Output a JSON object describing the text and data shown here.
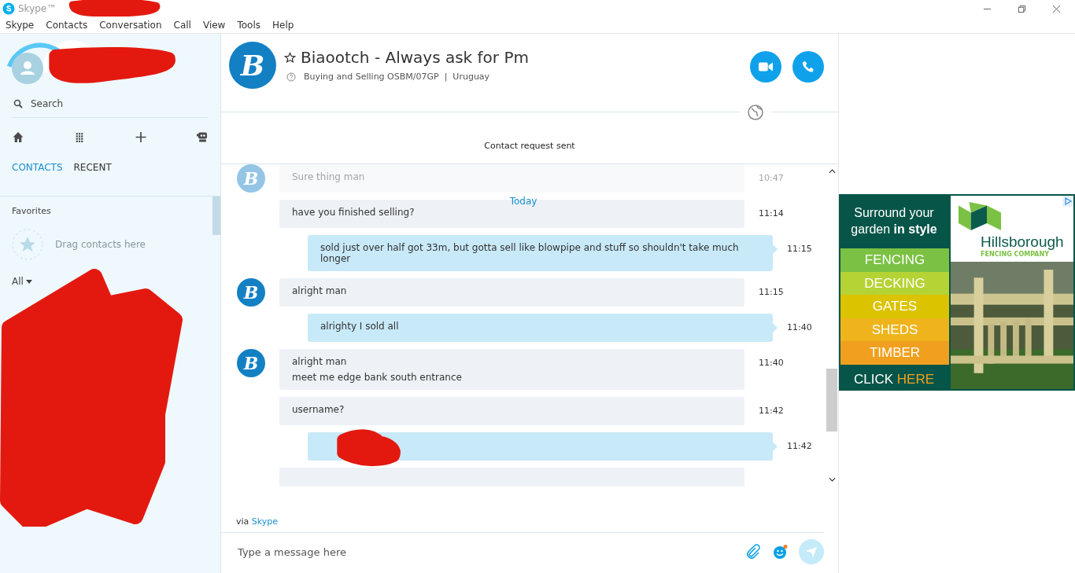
{
  "window": {
    "title": "Skype™"
  },
  "menu": [
    "Skype",
    "Contacts",
    "Conversation",
    "Call",
    "View",
    "Tools",
    "Help"
  ],
  "sidebar": {
    "search": "Search",
    "tabs": [
      {
        "label": "CONTACTS",
        "selected": true
      },
      {
        "label": "RECENT",
        "selected": false
      }
    ],
    "favorites": "Favorites",
    "drag_hint": "Drag contacts here",
    "filter": "All"
  },
  "chat": {
    "avatar_letter": "B",
    "name": "Biaootch - Always ask for Pm",
    "mood": "Buying and Selling OSBM/07GP",
    "separator": "|",
    "location": "Uruguay",
    "notice": "Contact request sent",
    "day": "Today",
    "messages": [
      {
        "kind": "in",
        "faded": true,
        "avatar": "B",
        "lines": [
          "Sure thing man"
        ],
        "time": "10:47"
      },
      {
        "kind": "in",
        "faded": false,
        "lines": [
          "have you finished selling?"
        ],
        "time": "11:14"
      },
      {
        "kind": "out",
        "faded": false,
        "lines": [
          "sold just over half got 33m, but gotta sell like blowpipe and stuff so shouldn't take much longer"
        ],
        "time": "11:15"
      },
      {
        "kind": "in",
        "faded": false,
        "avatar": "B",
        "lines": [
          "alright man"
        ],
        "time": "11:15"
      },
      {
        "kind": "out",
        "faded": false,
        "lines": [
          "alrighty I sold all"
        ],
        "time": "11:40"
      },
      {
        "kind": "in",
        "faded": false,
        "avatar": "B",
        "lines": [
          "alright man",
          "meet me edge bank south entrance"
        ],
        "time": "11:40"
      },
      {
        "kind": "in",
        "faded": false,
        "lines": [
          "username?"
        ],
        "time": "11:42"
      },
      {
        "kind": "out",
        "faded": false,
        "redacted": true,
        "time": "11:42"
      },
      {
        "kind": "in"
      }
    ],
    "via": "via",
    "via_link": "Skype",
    "placeholder": "Type a message here"
  },
  "ad": {
    "headline": "Surround your garden **in style**",
    "items": [
      {
        "label": "FENCING",
        "color": "#7bc143"
      },
      {
        "label": "DECKING",
        "color": "#b5d334"
      },
      {
        "label": "GATES",
        "color": "#dcc300"
      },
      {
        "label": "SHEDS",
        "color": "#efb41c"
      },
      {
        "label": "TIMBER",
        "color": "#f0a01e"
      }
    ],
    "cta": "CLICK",
    "cta_accent": "HERE",
    "brand": "Hillsborough",
    "brand_sub": "FENCING COMPANY"
  }
}
